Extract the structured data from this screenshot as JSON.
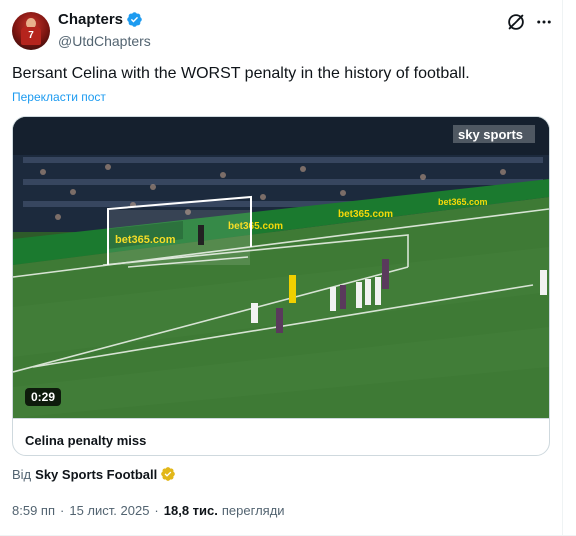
{
  "author": {
    "display_name": "Chapters",
    "handle": "@UtdChapters",
    "avatar_number": "7",
    "verified_color": "#1d9bf0"
  },
  "tweet": {
    "text": "Bersant Celina with the WORST penalty in the history of football.",
    "translate_label": "Перекласти пост"
  },
  "media": {
    "duration": "0:29",
    "title": "Celina penalty miss",
    "broadcaster_logo": "sky sports",
    "board_text": "bet365.com"
  },
  "source": {
    "prefix": "Від",
    "name": "Sky Sports Football",
    "badge_color": "#e2b719"
  },
  "meta": {
    "time": "8:59 пп",
    "separator": "·",
    "date": "15 лист. 2025",
    "views_count": "18,8 тис.",
    "views_label": "перегляди"
  },
  "icons": {
    "grok": "grok-icon",
    "more": "more-dots-icon",
    "verified": "verified-badge-icon",
    "affiliate": "gold-affiliate-badge-icon"
  }
}
